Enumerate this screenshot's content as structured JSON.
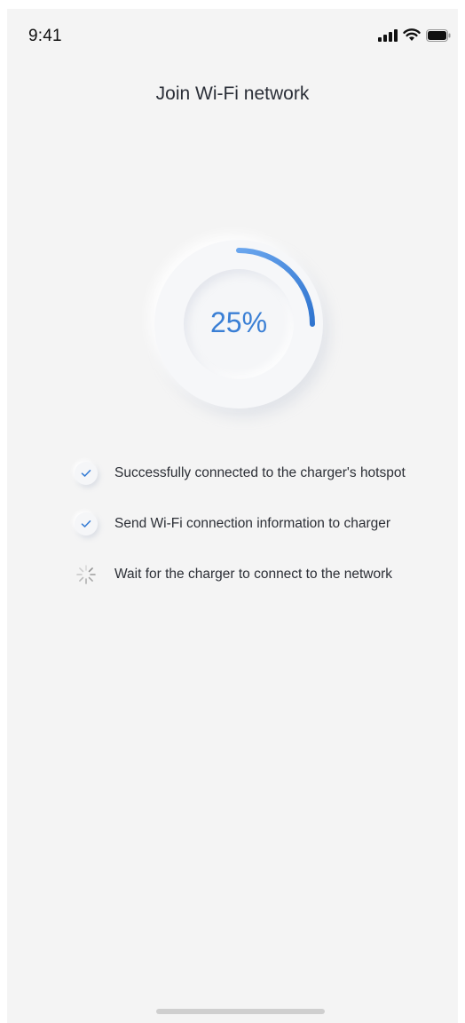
{
  "status_bar": {
    "time": "9:41",
    "icons": [
      "signal-icon",
      "wifi-icon",
      "battery-icon"
    ]
  },
  "header": {
    "title": "Join Wi-Fi network"
  },
  "progress": {
    "label": "25%",
    "value": 0.25,
    "color": "#3a7fd5"
  },
  "steps": [
    {
      "label": "Successfully connected to the charger's hotspot",
      "status": "done",
      "icon": "check-icon"
    },
    {
      "label": "Send Wi-Fi connection information to charger",
      "status": "done",
      "icon": "check-icon"
    },
    {
      "label": "Wait for the charger to connect to the network",
      "status": "in-progress",
      "icon": "spinner-icon"
    }
  ],
  "colors": {
    "accent": "#3a7fd5",
    "background": "#f4f4f4",
    "text": "#2c2f36"
  }
}
